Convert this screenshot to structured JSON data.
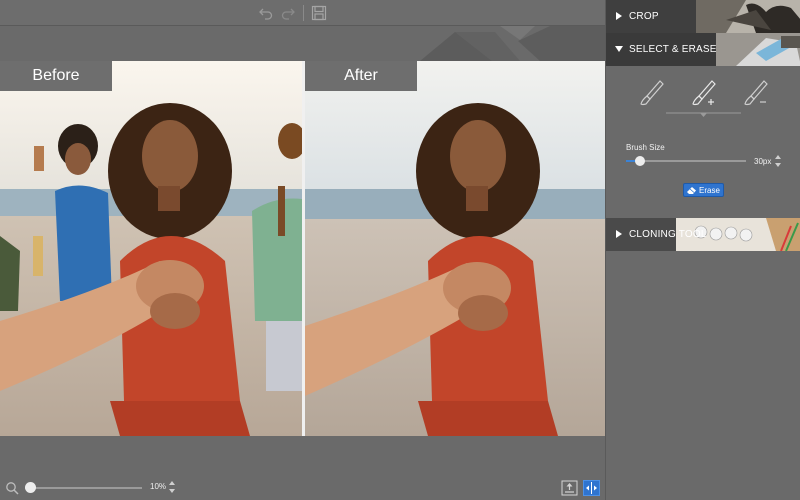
{
  "toolbar": {
    "undo_icon": "undo-icon",
    "redo_icon": "redo-icon",
    "save_icon": "save-icon"
  },
  "canvas": {
    "before_label": "Before",
    "after_label": "After"
  },
  "bottombar": {
    "zoom_value": "10%",
    "zoom_fraction": 0.05
  },
  "panel": {
    "sections": [
      {
        "label": "CROP",
        "expanded": false
      },
      {
        "label": "SELECT & ERASE",
        "expanded": true
      },
      {
        "label": "CLONING TOOL",
        "expanded": false
      }
    ],
    "brush_tools": [
      "brush-icon",
      "brush-add-icon",
      "brush-subtract-icon"
    ],
    "selected_brush": 1,
    "brush_size_label": "Brush Size",
    "brush_size_value": "30px",
    "brush_size_fraction": 0.12,
    "erase_label": "Erase"
  },
  "colors": {
    "accent": "#2f74cf",
    "background": "#6a6a6a",
    "divider": "#f0f0f0"
  }
}
